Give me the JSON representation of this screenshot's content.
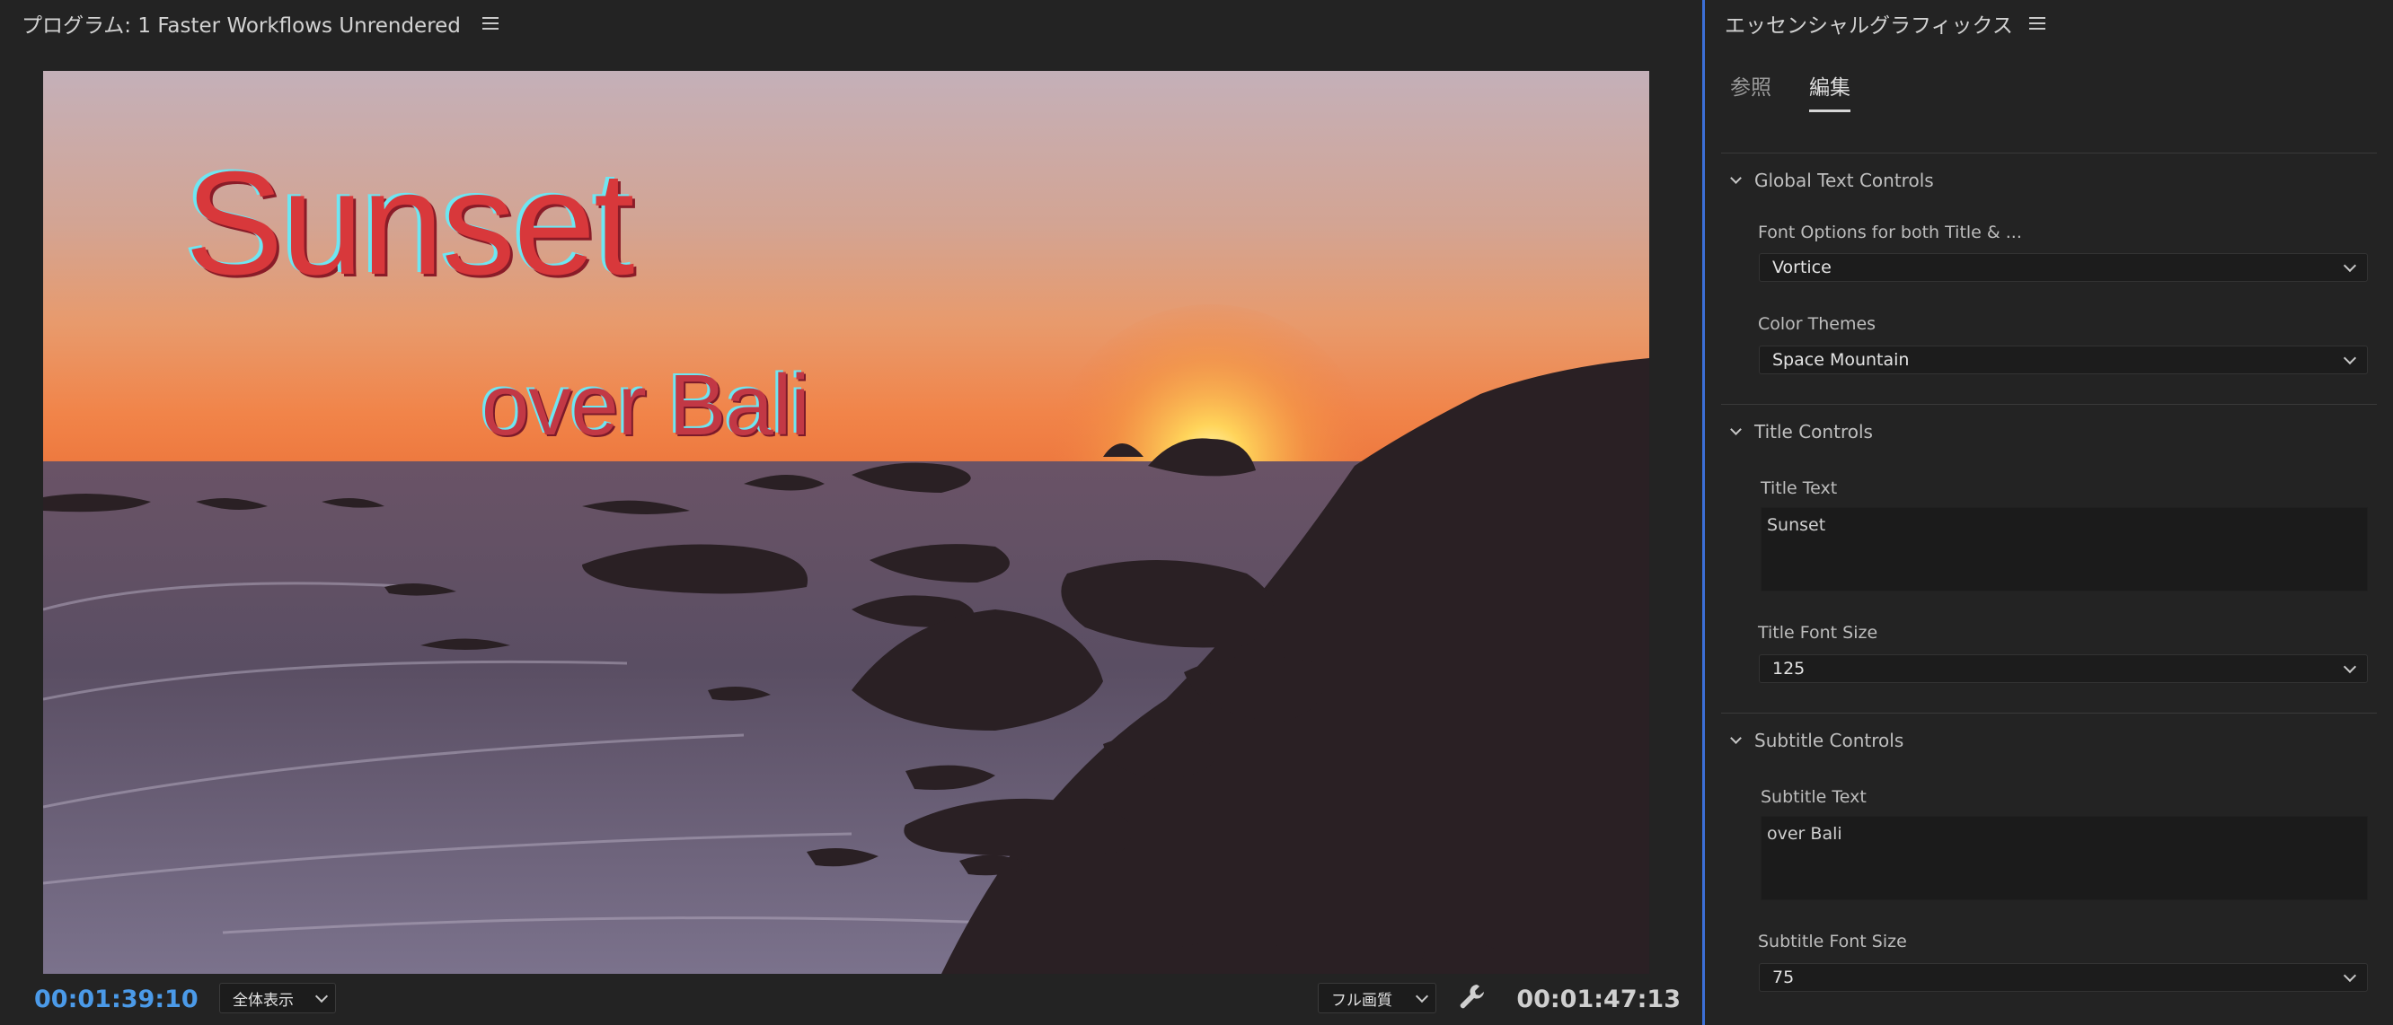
{
  "program": {
    "title": "プログラム: 1 Faster Workflows Unrendered",
    "overlay_title": "Sunset",
    "overlay_subtitle": "over Bali",
    "current_time": "00:01:39:10",
    "duration": "00:01:47:13",
    "zoom_value": "全体表示",
    "quality_value": "フル画質",
    "icons": [
      "panel-menu-icon",
      "chevron-down-icon",
      "wrench-icon"
    ]
  },
  "essential_graphics": {
    "title": "エッセンシャルグラフィックス",
    "tabs": [
      {
        "label": "参照",
        "active": false
      },
      {
        "label": "編集",
        "active": true
      }
    ],
    "sections": {
      "global": {
        "title": "Global Text Controls",
        "font_label": "Font Options for both Title & ...",
        "font_value": "Vortice",
        "theme_label": "Color Themes",
        "theme_value": "Space Mountain"
      },
      "title": {
        "title": "Title Controls",
        "text_label": "Title Text",
        "text_value": "Sunset",
        "size_label": "Title Font Size",
        "size_value": "125"
      },
      "subtitle": {
        "title": "Subtitle Controls",
        "text_label": "Subtitle Text",
        "text_value": "over Bali",
        "size_label": "Subtitle Font Size",
        "size_value": "75"
      }
    }
  },
  "colors": {
    "timecode_current": "#4b9ae8",
    "panel_divider": "#3c6fd6",
    "title_fill": "#d8383b",
    "title_offset": "#6ee6f2"
  }
}
